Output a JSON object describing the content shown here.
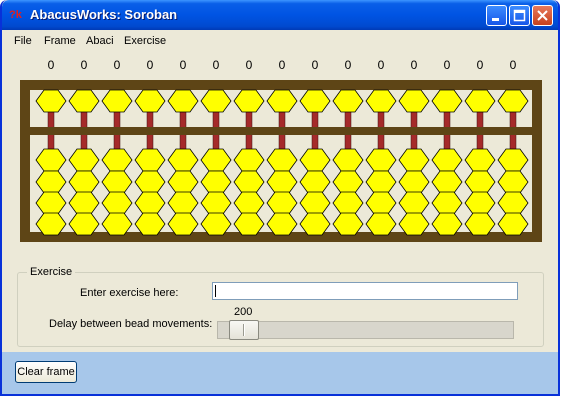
{
  "window": {
    "title": "AbacusWorks: Soroban",
    "icon_text": "?k"
  },
  "menu": [
    "File",
    "Frame",
    "Abaci",
    "Exercise"
  ],
  "digits": [
    "0",
    "0",
    "0",
    "0",
    "0",
    "0",
    "0",
    "0",
    "0",
    "0",
    "0",
    "0",
    "0",
    "0",
    "0"
  ],
  "colors": {
    "frame": "#5e4516",
    "rod": "#a52a2a",
    "bead": "#ffff00",
    "bead_outline": "#000000"
  },
  "exercise": {
    "group_label": "Exercise",
    "input_label": "Enter exercise here:",
    "input_value": "",
    "delay_label": "Delay between bead movements:",
    "delay_value": "200",
    "delay_fraction": 0.04
  },
  "buttons": {
    "clear_frame": "Clear frame"
  }
}
